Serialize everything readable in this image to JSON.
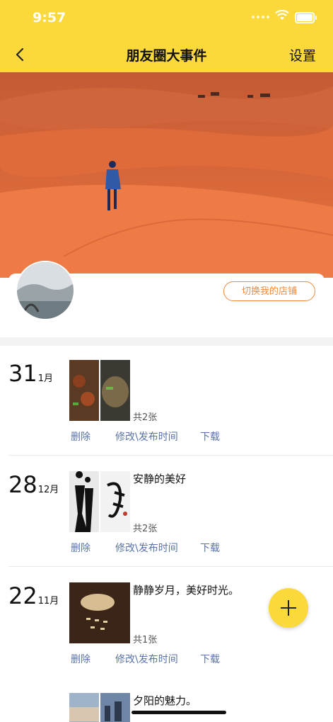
{
  "status": {
    "time": "9:57"
  },
  "nav": {
    "title": "朋友圈大事件",
    "settings": "设置"
  },
  "profile": {
    "switch_store": "切换我的店铺"
  },
  "actions": {
    "delete": "删除",
    "edit_time": "修改\\发布时间",
    "download": "下载"
  },
  "posts": [
    {
      "day": "31",
      "month": "1月",
      "caption": "",
      "count": "共2张"
    },
    {
      "day": "28",
      "month": "12月",
      "caption": "安静的美好",
      "count": "共2张"
    },
    {
      "day": "22",
      "month": "11月",
      "caption": "静静岁月，美好时光。",
      "count": "共1张"
    },
    {
      "caption": "夕阳的魅力。"
    }
  ],
  "icons": {
    "back": "chevron-left-icon",
    "add": "plus-icon"
  },
  "colors": {
    "accent": "#fcd93a",
    "link": "#5a73a8",
    "store_button": "#f08a3c"
  }
}
